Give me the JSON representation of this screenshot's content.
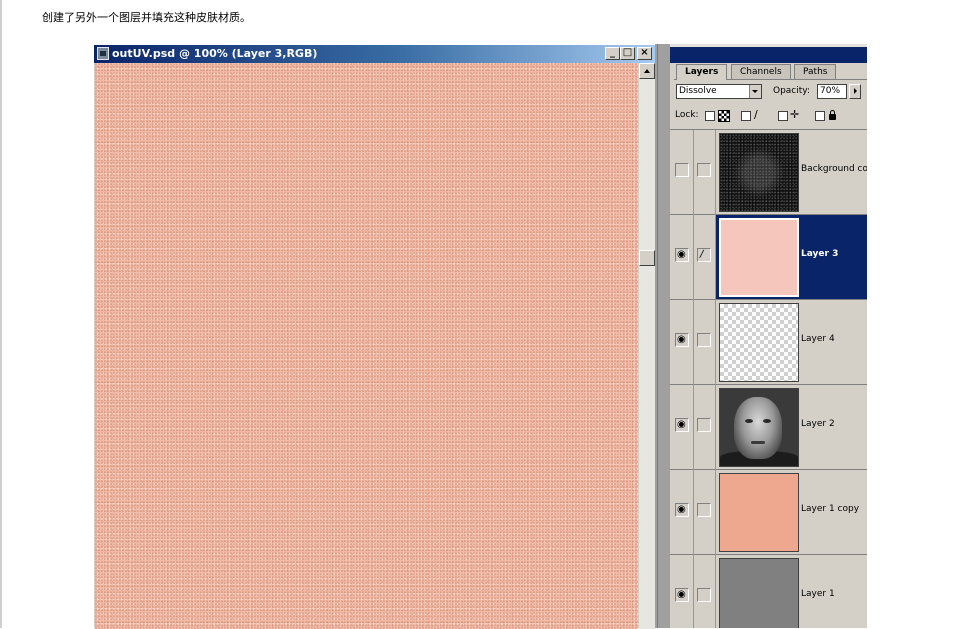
{
  "caption": "创建了另外一个图层并填充这种皮肤材质。",
  "document_window": {
    "title": "outUV.psd @ 100% (Layer 3,RGB)",
    "buttons": {
      "minimize": "_",
      "maximize": "□",
      "close": "×"
    },
    "canvas_color": "#f2bba8"
  },
  "layers_palette": {
    "tabs": [
      {
        "label": "Layers",
        "active": true
      },
      {
        "label": "Channels",
        "active": false
      },
      {
        "label": "Paths",
        "active": false
      }
    ],
    "blend_mode": "Dissolve",
    "opacity_label": "Opacity:",
    "opacity_value": "70%",
    "lock_label": "Lock:",
    "layers": [
      {
        "name": "Background copy",
        "visible": false,
        "selected": false,
        "thumbnail": "dark-edge-map"
      },
      {
        "name": "Layer 3",
        "visible": true,
        "selected": true,
        "thumbnail": "pink-fill"
      },
      {
        "name": "Layer 4",
        "visible": true,
        "selected": false,
        "thumbnail": "transparent"
      },
      {
        "name": "Layer 2",
        "visible": true,
        "selected": false,
        "thumbnail": "face-render"
      },
      {
        "name": "Layer 1 copy",
        "visible": true,
        "selected": false,
        "thumbnail": "salmon-fill"
      },
      {
        "name": "Layer 1",
        "visible": true,
        "selected": false,
        "thumbnail": "gray-fill"
      }
    ],
    "icons": {
      "eye": "eye-icon",
      "brush": "brush-icon"
    }
  }
}
